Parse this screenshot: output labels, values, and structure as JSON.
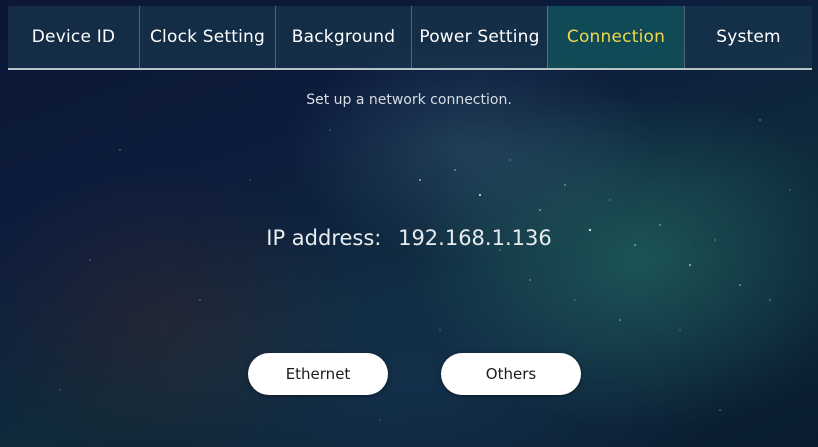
{
  "tabs": [
    {
      "label": "Device ID",
      "active": false
    },
    {
      "label": "Clock Setting",
      "active": false
    },
    {
      "label": "Background",
      "active": false
    },
    {
      "label": "Power Setting",
      "active": false
    },
    {
      "label": "Connection",
      "active": true
    },
    {
      "label": "System",
      "active": false
    }
  ],
  "connection": {
    "subtitle": "Set up a network connection.",
    "ip_label": "IP address:",
    "ip_value": "192.168.1.136",
    "buttons": {
      "ethernet": "Ethernet",
      "others": "Others"
    }
  },
  "colors": {
    "active_tab_text": "#f0d84a",
    "tab_text": "#ffffff",
    "button_bg": "#ffffff"
  }
}
